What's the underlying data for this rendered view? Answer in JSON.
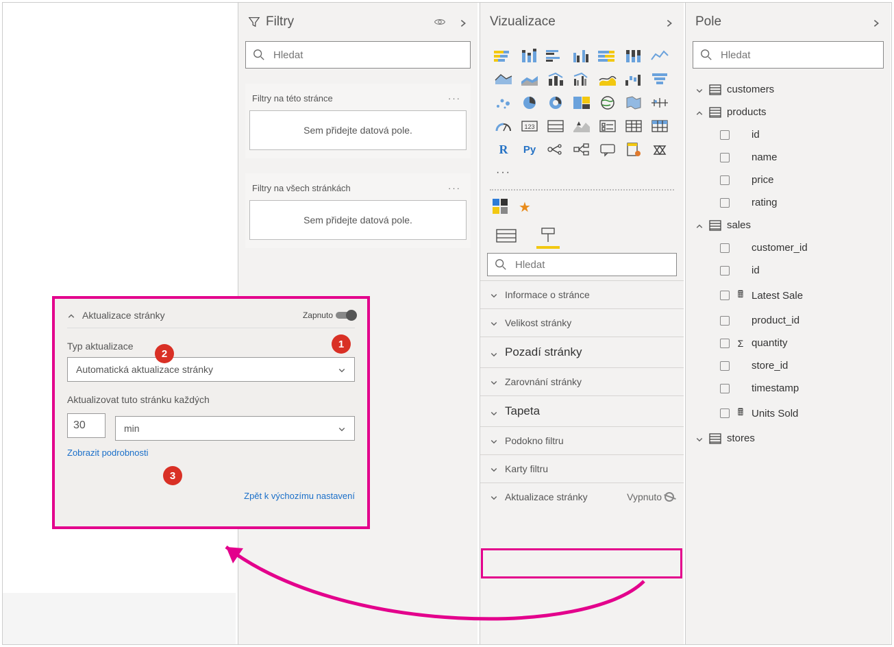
{
  "filters": {
    "title": "Filtry",
    "search_placeholder": "Hledat",
    "page_filters_label": "Filtry na této stránce",
    "all_filters_label": "Filtry na všech stránkách",
    "drop_hint": "Sem přidejte datová pole."
  },
  "visualizations": {
    "title": "Vizualizace",
    "search_placeholder": "Hledat",
    "sections": {
      "page_info": "Informace o stránce",
      "page_size": "Velikost stránky",
      "page_background": "Pozadí stránky",
      "page_alignment": "Zarovnání stránky",
      "wallpaper": "Tapeta",
      "filter_pane": "Podokno filtru",
      "filter_cards": "Karty filtru",
      "page_refresh": "Aktualizace stránky",
      "page_refresh_state": "Vypnuto"
    }
  },
  "fields": {
    "title": "Pole",
    "search_placeholder": "Hledat",
    "tables": [
      {
        "name": "customers",
        "expanded": false,
        "cols": []
      },
      {
        "name": "products",
        "expanded": true,
        "cols": [
          {
            "name": "id"
          },
          {
            "name": "name"
          },
          {
            "name": "price"
          },
          {
            "name": "rating"
          }
        ]
      },
      {
        "name": "sales",
        "expanded": true,
        "cols": [
          {
            "name": "customer_id"
          },
          {
            "name": "id"
          },
          {
            "name": "Latest Sale",
            "glyph": "calc"
          },
          {
            "name": "product_id"
          },
          {
            "name": "quantity",
            "glyph": "sigma"
          },
          {
            "name": "store_id"
          },
          {
            "name": "timestamp"
          },
          {
            "name": "Units Sold",
            "glyph": "calc"
          }
        ]
      },
      {
        "name": "stores",
        "expanded": false,
        "cols": []
      }
    ]
  },
  "callout": {
    "section_title": "Aktualizace stránky",
    "state": "Zapnuto",
    "update_type_label": "Typ aktualizace",
    "update_type_value": "Automatická aktualizace stránky",
    "interval_label": "Aktualizovat tuto stránku každých",
    "interval_value": "30",
    "interval_unit": "min",
    "show_details": "Zobrazit podrobnosti",
    "reset": "Zpět k výchozímu nastavení"
  },
  "badges": {
    "one": "1",
    "two": "2",
    "three": "3"
  }
}
